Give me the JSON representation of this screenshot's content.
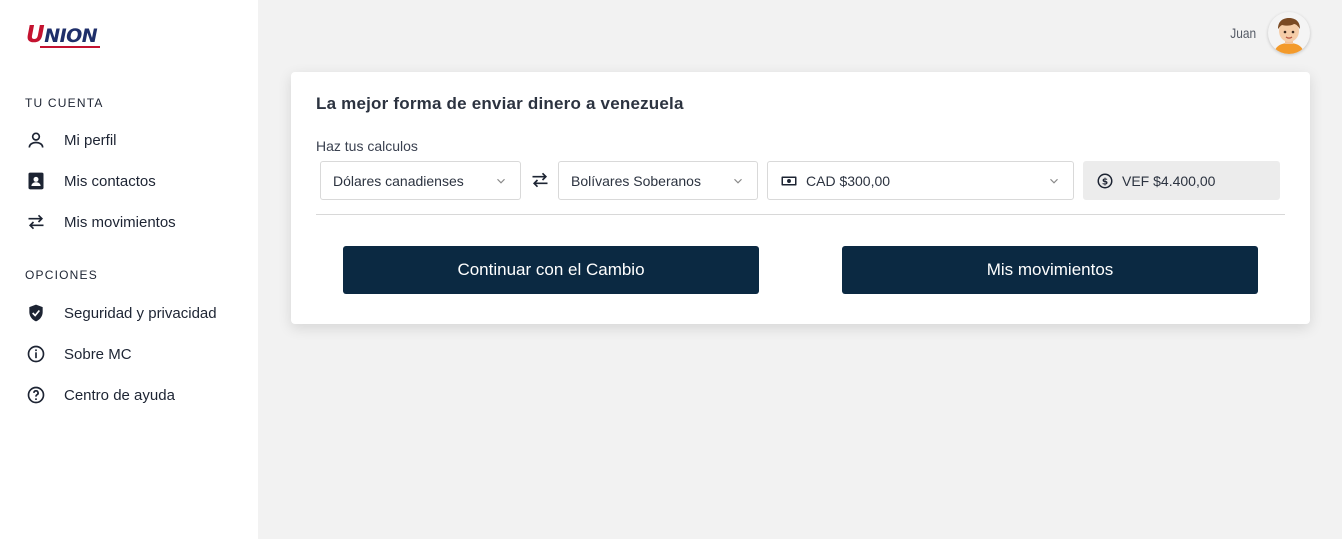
{
  "brand": {
    "logo_text": "UNION"
  },
  "sidebar": {
    "sections": [
      {
        "title": "TU CUENTA"
      },
      {
        "title": "OPCIONES"
      }
    ],
    "items": [
      {
        "label": "Mi perfil",
        "icon": "person-icon"
      },
      {
        "label": "Mis contactos",
        "icon": "contacts-icon"
      },
      {
        "label": "Mis movimientos",
        "icon": "swap-icon"
      },
      {
        "label": "Seguridad y privacidad",
        "icon": "shield-icon"
      },
      {
        "label": "Sobre MC",
        "icon": "info-icon"
      },
      {
        "label": "Centro de ayuda",
        "icon": "help-icon"
      }
    ]
  },
  "user": {
    "name": "Juan"
  },
  "card": {
    "title": "La mejor forma de enviar dinero a venezuela",
    "calc_label": "Haz tus calculos",
    "from_currency": "Dólares canadienses",
    "to_currency": "Bolívares Soberanos",
    "amount": "CAD $300,00",
    "result": "VEF $4.400,00",
    "continue_button": "Continuar con el Cambio",
    "movements_button": "Mis movimientos"
  },
  "colors": {
    "primary": "#0b2942",
    "background": "#f2f2f2",
    "brand_red": "#c4122f",
    "brand_blue": "#1f2f6a"
  }
}
